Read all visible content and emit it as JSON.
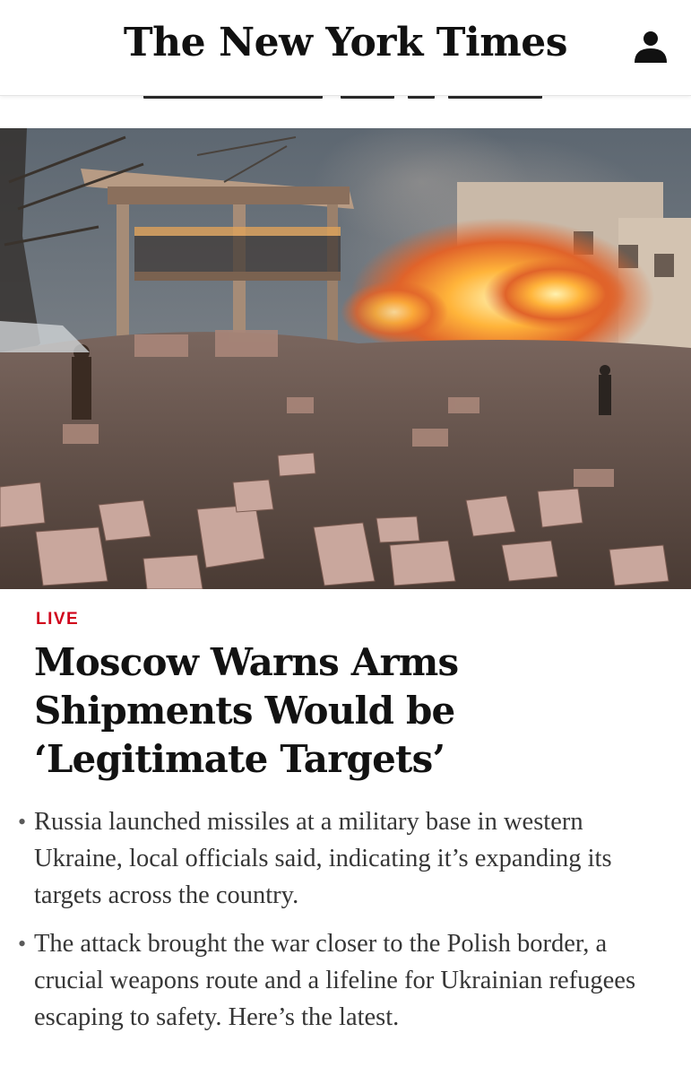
{
  "header": {
    "masthead": "The New York Times",
    "account_icon": "person-icon"
  },
  "hero": {
    "image_description_icon": "photo-destroyed-building",
    "colors": {
      "sky": "#5f6a74",
      "fire": "#f7a531",
      "rubble": "#8b6f62"
    }
  },
  "article": {
    "label": "LIVE",
    "label_color": "#d0021b",
    "headline": "Moscow Warns Arms Shipments Would be ‘Legitimate Targets’",
    "summary": [
      "Russia launched missiles at a military base in western Ukraine, local officials said, indicating it’s expanding its targets across the country.",
      "The attack brought the war closer to the Polish border, a crucial weapons route and a lifeline for Ukrainian refugees escaping to safety. Here’s the latest."
    ],
    "bullet_glyph": "•"
  }
}
